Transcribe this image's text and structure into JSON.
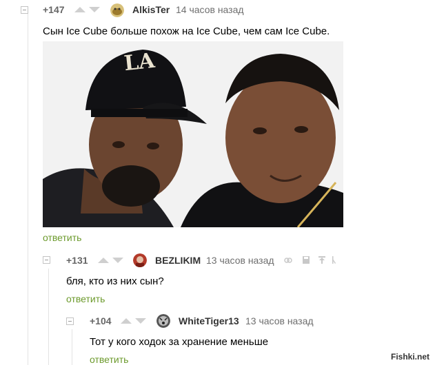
{
  "comments": [
    {
      "rating": "+147",
      "username": "AlkisTer",
      "time": "14 часов назад",
      "text": "Сын Ice Cube больше похож на Ice Cube, чем сам Ice Cube.",
      "reply": "ответить"
    },
    {
      "rating": "+131",
      "username": "BEZLIKIM",
      "time": "13 часов назад",
      "text": "бля, кто из них сын?",
      "reply": "ответить",
      "tools": [
        "link-icon",
        "save-icon",
        "share-up-icon",
        "more-icon"
      ]
    },
    {
      "rating": "+104",
      "username": "WhiteTiger13",
      "time": "13 часов назад",
      "text": "Тот у кого ходок за хранение меньше",
      "reply": "ответить"
    }
  ],
  "image": {
    "cap_text": "LA"
  },
  "watermark": "Fishki.net",
  "colors": {
    "reply_link": "#6c9a2c",
    "vote_arrow": "#cfcfcf",
    "thread_line": "#e3e3e3"
  }
}
